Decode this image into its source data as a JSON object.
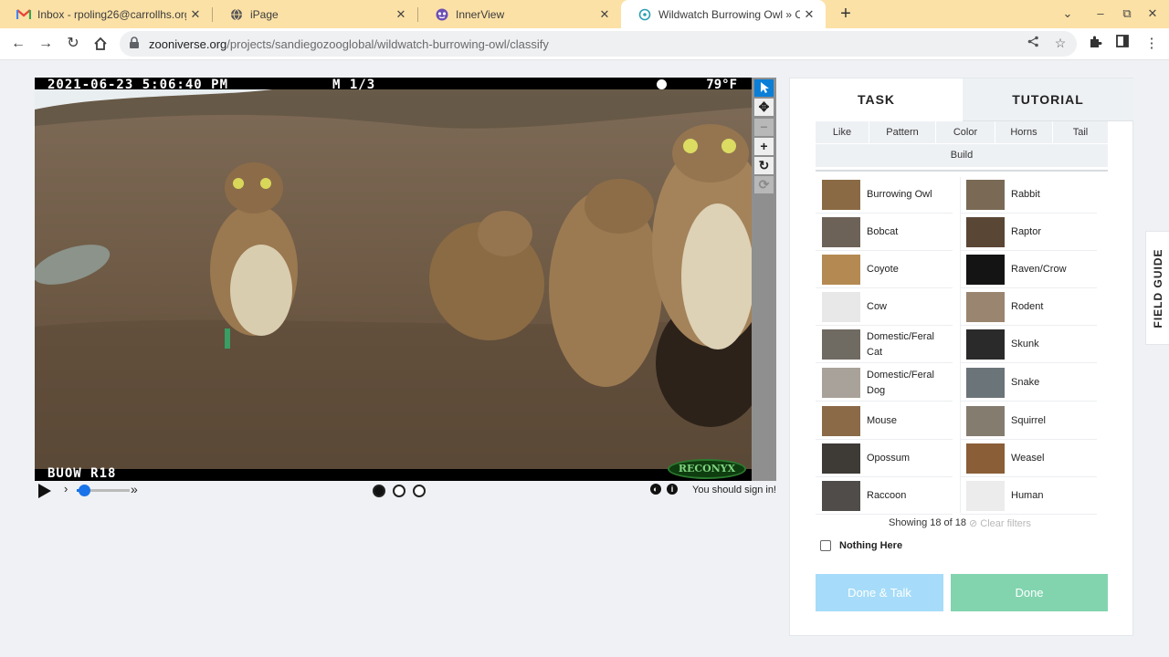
{
  "browser": {
    "tabs": [
      {
        "title": "Inbox - rpoling26@carrollhs.org",
        "icon": "gmail-icon",
        "active": false
      },
      {
        "title": "iPage",
        "icon": "globe-icon",
        "active": false
      },
      {
        "title": "InnerView",
        "icon": "innerview-icon",
        "active": false
      },
      {
        "title": "Wildwatch Burrowing Owl » Clas",
        "icon": "zooniverse-icon",
        "active": true
      }
    ],
    "new_tab": "+",
    "url_domain": "zooniverse.org",
    "url_path": "/projects/sandiegozooglobal/wildwatch-burrowing-owl/classify",
    "colors": {
      "tabstrip": "#fce1a6",
      "omnibox": "#eff0f2"
    }
  },
  "viewer": {
    "timestamp": "2021-06-23 5:06:40 PM",
    "frame": "M 1/3",
    "temperature": "79°F",
    "camera_id": "BUOW R18",
    "brand": "RECONYX",
    "tools": [
      "pointer-icon",
      "move-icon",
      "zoom-out-icon",
      "zoom-in-icon",
      "rotate-icon",
      "reset-icon"
    ],
    "frames": 3,
    "current_frame": 1,
    "sign_in_note": "You should sign in!"
  },
  "panel": {
    "tab_task": "TASK",
    "tab_tutorial": "TUTORIAL",
    "filters": [
      "Like",
      "Pattern",
      "Color",
      "Horns",
      "Tail",
      "Build"
    ],
    "choices": [
      {
        "label": "Burrowing Owl",
        "color": "#8a6a44"
      },
      {
        "label": "Rabbit",
        "color": "#7a6a55"
      },
      {
        "label": "Bobcat",
        "color": "#6d6258"
      },
      {
        "label": "Raptor",
        "color": "#5a4634"
      },
      {
        "label": "Coyote",
        "color": "#b48a52"
      },
      {
        "label": "Raven/Crow",
        "color": "#141414"
      },
      {
        "label": "Cow",
        "color": "#e8e8e8"
      },
      {
        "label": "Rodent",
        "color": "#9a8570"
      },
      {
        "label": "Domestic/Feral Cat",
        "color": "#6f6a62"
      },
      {
        "label": "Skunk",
        "color": "#2a2a2a"
      },
      {
        "label": "Domestic/Feral Dog",
        "color": "#a8a29a"
      },
      {
        "label": "Snake",
        "color": "#6b7479"
      },
      {
        "label": "Mouse",
        "color": "#8b6a48"
      },
      {
        "label": "Squirrel",
        "color": "#857c70"
      },
      {
        "label": "Opossum",
        "color": "#3e3a36"
      },
      {
        "label": "Weasel",
        "color": "#8a5e36"
      },
      {
        "label": "Raccoon",
        "color": "#4f4c4a"
      },
      {
        "label": "Human",
        "color": "#ececec"
      }
    ],
    "showing": "Showing 18 of 18",
    "clear_filters": "Clear filters",
    "nothing_here": "Nothing Here",
    "done_talk": "Done & Talk",
    "done": "Done",
    "colors": {
      "done_talk": "#a6dcf9",
      "done": "#82d4ae"
    }
  },
  "field_guide": "FIELD GUIDE"
}
